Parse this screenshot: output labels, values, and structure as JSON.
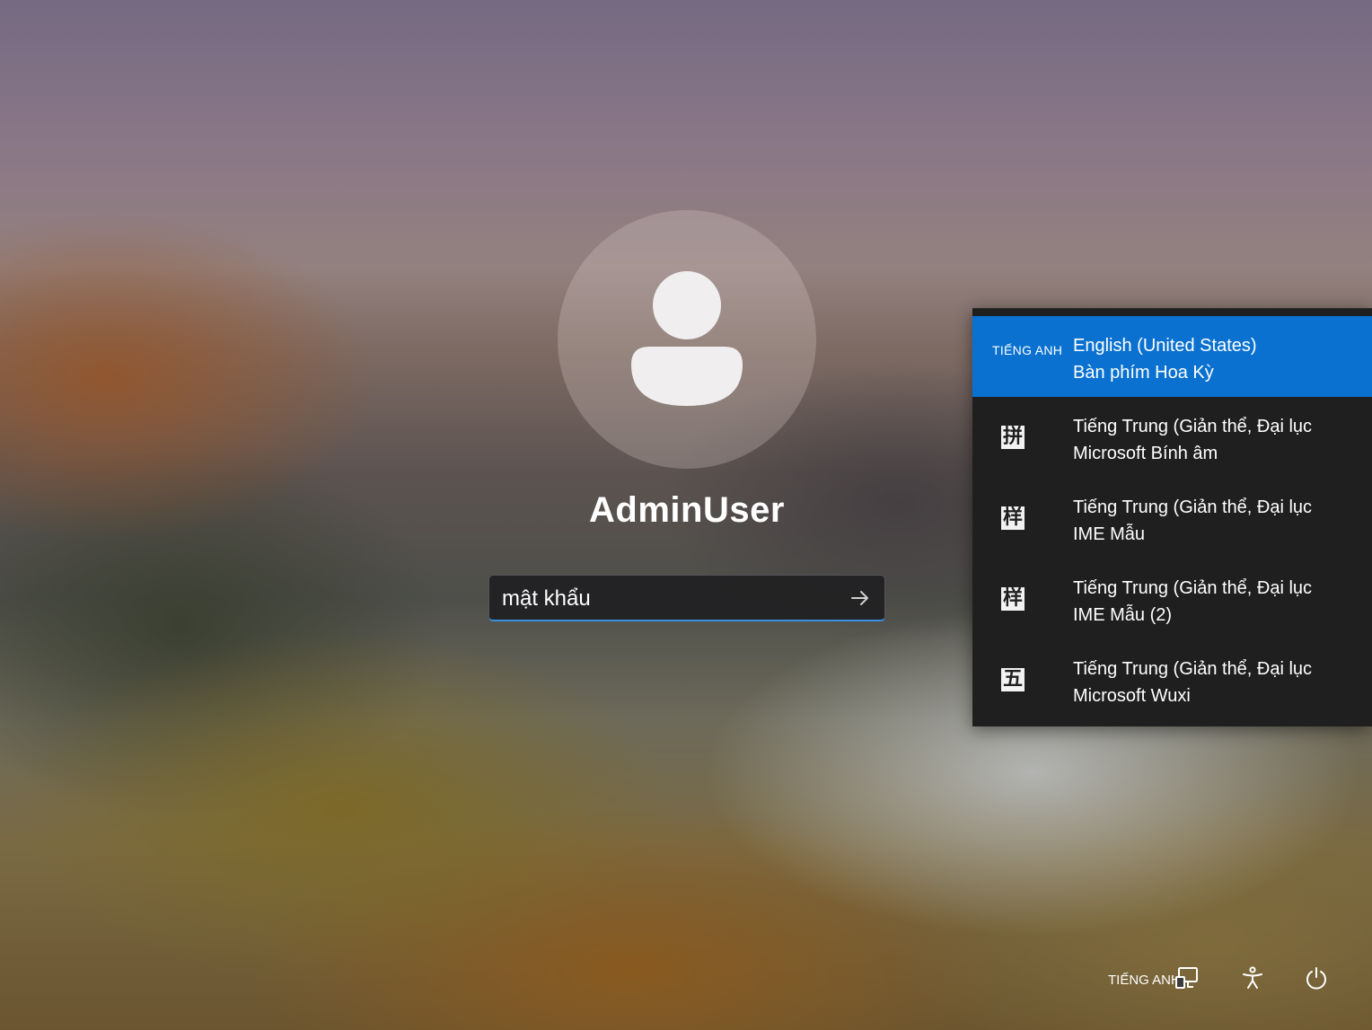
{
  "user": {
    "name": "AdminUser"
  },
  "password": {
    "placeholder": "mật khẩu"
  },
  "language_menu": {
    "items": [
      {
        "tag": "TIẾNG ANH",
        "line1": "English (United States)",
        "line2": "Bàn phím Hoa Kỳ",
        "selected": true
      },
      {
        "glyph": "拼",
        "line1": "Tiếng Trung (Giản thể, Đại lục",
        "line2": "Microsoft Bính âm"
      },
      {
        "glyph": "样",
        "line1": "Tiếng Trung (Giản thể, Đại lục",
        "line2": "IME Mẫu"
      },
      {
        "glyph": "样",
        "line1": "Tiếng Trung (Giản thể, Đại lục",
        "line2": "IME Mẫu (2)"
      },
      {
        "glyph": "五",
        "line1": "Tiếng Trung (Giản thể, Đại lục",
        "line2": "Microsoft Wuxi"
      }
    ]
  },
  "tray": {
    "language_label": "TIẾNG ANH",
    "icons": [
      "network-icon",
      "accessibility-icon",
      "power-icon"
    ]
  },
  "colors": {
    "selection": "#0a71d1",
    "menu_bg": "#1f1f1f",
    "input_accent": "#3b8fe0"
  }
}
